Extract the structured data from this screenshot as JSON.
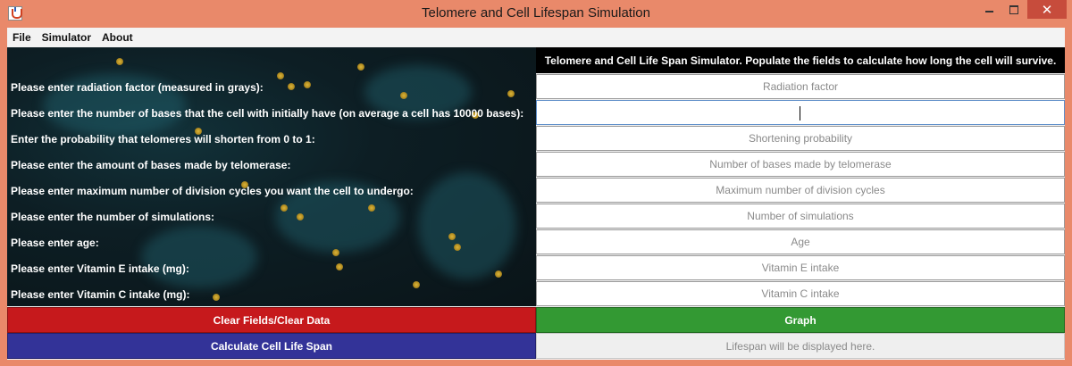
{
  "window": {
    "title": "Telomere and Cell Lifespan Simulation",
    "close_glyph": "✕"
  },
  "menu": [
    "File",
    "Simulator",
    "About"
  ],
  "header": "Telomere and Cell Life Span Simulator.   Populate the fields to calculate how long the cell will survive.",
  "fields": [
    {
      "label": "Please enter radiation factor (measured in grays):",
      "placeholder": "Radiation factor",
      "value": ""
    },
    {
      "label": "Please enter the number of bases that the cell with initially have (on average a cell has 10000 bases):",
      "placeholder": "",
      "value": ""
    },
    {
      "label": "Enter the probability that telomeres will shorten from 0 to 1:",
      "placeholder": "Shortening probability",
      "value": ""
    },
    {
      "label": "Please enter the amount of bases made by telomerase:",
      "placeholder": "Number of bases made by telomerase",
      "value": ""
    },
    {
      "label": "Please enter maximum number of division cycles you want the cell to undergo:",
      "placeholder": "Maximum number of division cycles",
      "value": ""
    },
    {
      "label": "Please enter the number of simulations:",
      "placeholder": "Number of simulations",
      "value": ""
    },
    {
      "label": "Please enter age:",
      "placeholder": "Age",
      "value": ""
    },
    {
      "label": "Please enter Vitamin E intake (mg):",
      "placeholder": "Vitamin E intake",
      "value": ""
    },
    {
      "label": "Please enter Vitamin C intake (mg):",
      "placeholder": "Vitamin C intake",
      "value": ""
    }
  ],
  "buttons": {
    "clear": "Clear Fields/Clear Data",
    "graph": "Graph",
    "calculate": "Calculate Cell Life Span"
  },
  "result_text": "Lifespan will be displayed here.",
  "colors": {
    "clear_button": "#c6191c",
    "graph_button": "#339933",
    "calculate_button": "#333398",
    "window_frame": "#e9896a"
  }
}
